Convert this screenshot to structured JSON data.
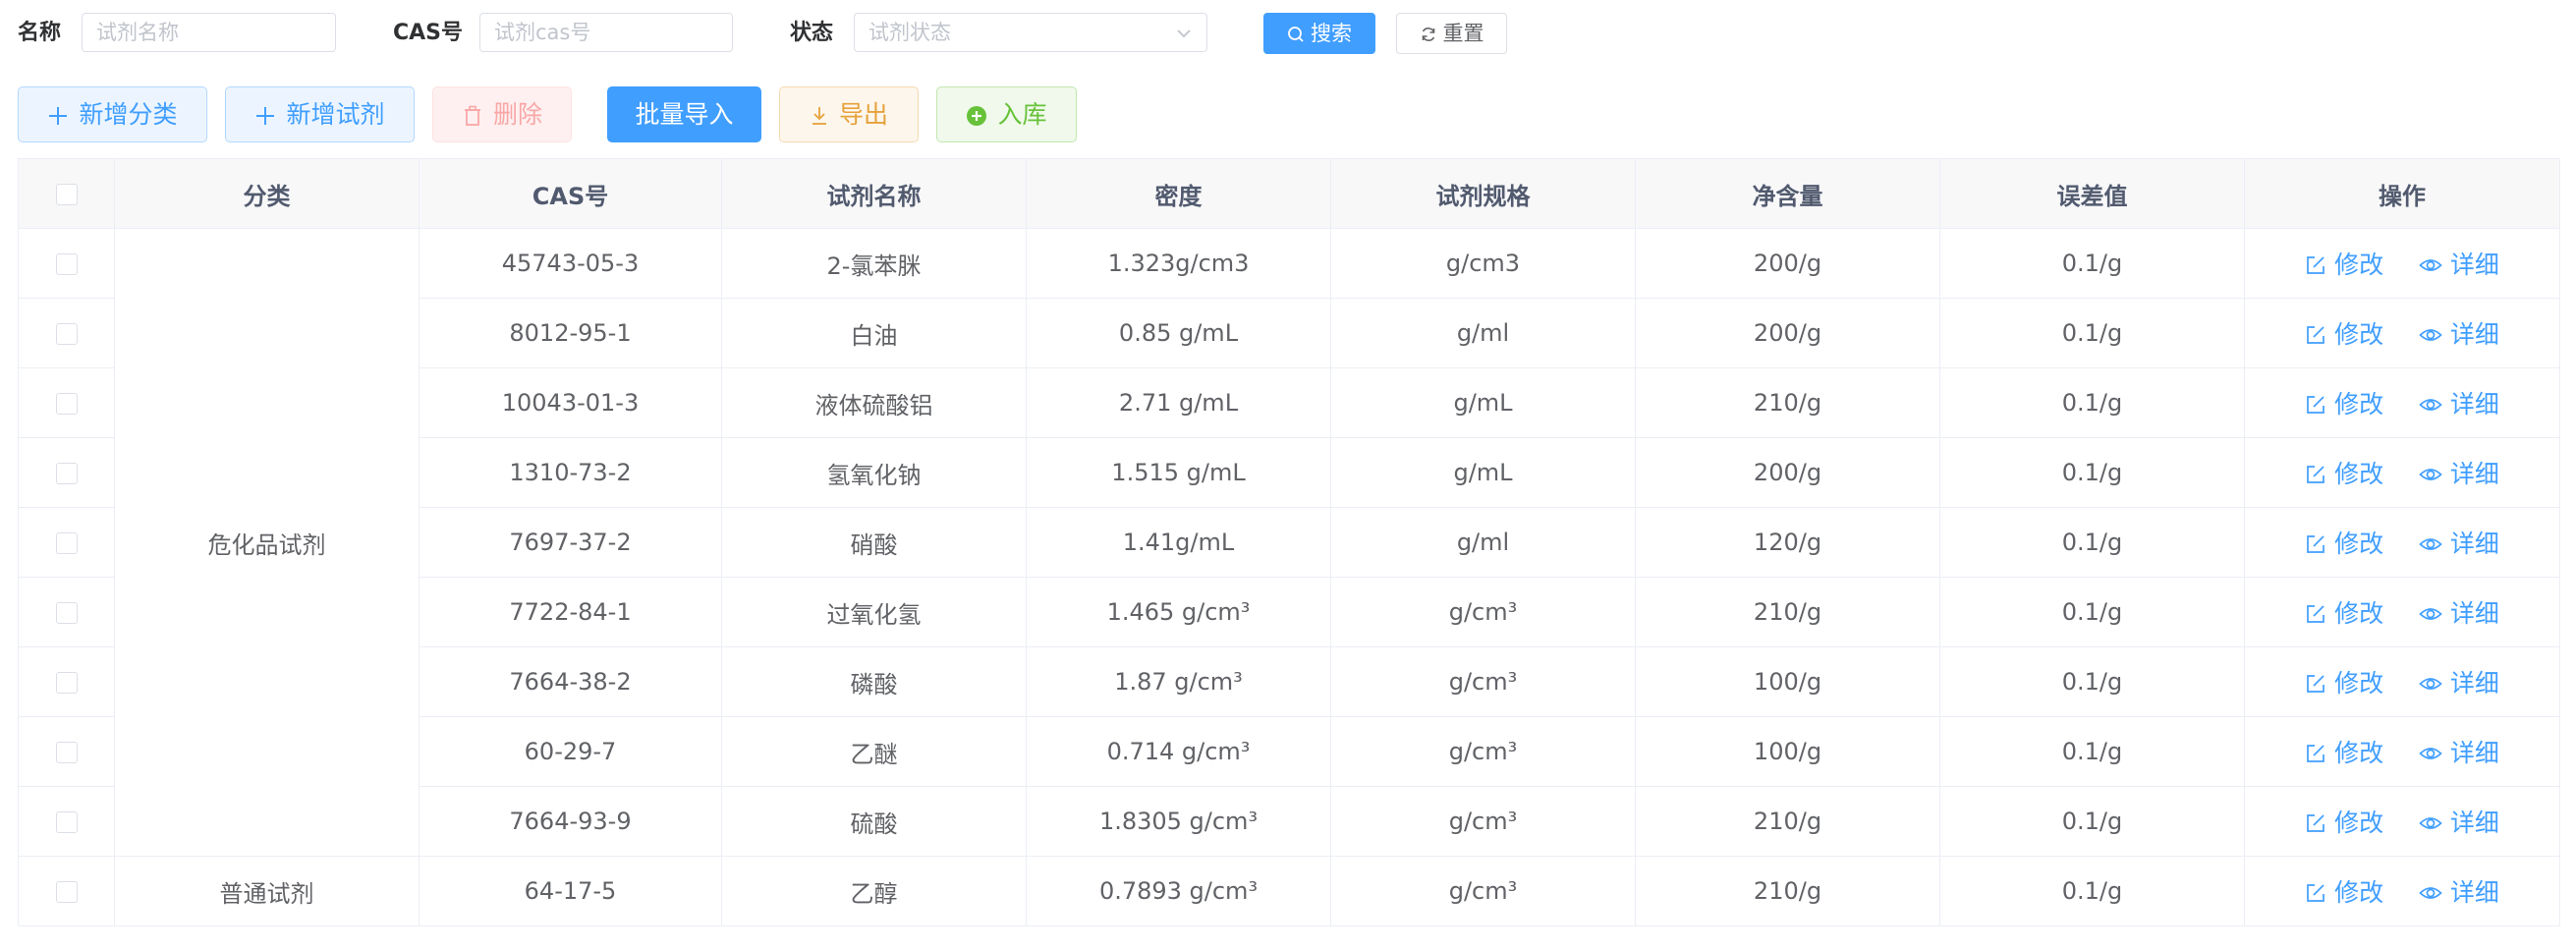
{
  "search": {
    "name_label": "名称",
    "name_placeholder": "试剂名称",
    "cas_label": "CAS号",
    "cas_placeholder": "试剂cas号",
    "status_label": "状态",
    "status_placeholder": "试剂状态",
    "search_button": "搜索",
    "reset_button": "重置"
  },
  "toolbar": {
    "add_category": "新增分类",
    "add_reagent": "新增试剂",
    "delete": "删除",
    "batch_import": "批量导入",
    "export": "导出",
    "stock_in": "入库"
  },
  "colors": {
    "primary": "#409eff",
    "warning": "#e6a23c",
    "success": "#67c23a",
    "danger": "#f56c6c"
  },
  "table": {
    "headers": [
      "分类",
      "CAS号",
      "试剂名称",
      "密度",
      "试剂规格",
      "净含量",
      "误差值",
      "操作"
    ],
    "action_edit": "修改",
    "action_detail": "详细",
    "groups": [
      {
        "category": "危化品试剂",
        "rows": [
          {
            "cas": "45743-05-3",
            "name": "2-氯苯脒",
            "density": "1.323g/cm3",
            "spec": "g/cm3",
            "net": "200/g",
            "error": "0.1/g"
          },
          {
            "cas": "8012-95-1",
            "name": "白油",
            "density": "0.85 g/mL",
            "spec": "g/ml",
            "net": "200/g",
            "error": "0.1/g"
          },
          {
            "cas": "10043-01-3",
            "name": "液体硫酸铝",
            "density": "2.71 g/mL",
            "spec": "g/mL",
            "net": "210/g",
            "error": "0.1/g"
          },
          {
            "cas": "1310-73-2",
            "name": "氢氧化钠",
            "density": "1.515 g/mL",
            "spec": "g/mL",
            "net": "200/g",
            "error": "0.1/g"
          },
          {
            "cas": "7697-37-2",
            "name": "硝酸",
            "density": "1.41g/mL",
            "spec": "g/ml",
            "net": "120/g",
            "error": "0.1/g"
          },
          {
            "cas": "7722-84-1",
            "name": "过氧化氢",
            "density": "1.465 g/cm³",
            "spec": "g/cm³",
            "net": "210/g",
            "error": "0.1/g"
          },
          {
            "cas": "7664-38-2",
            "name": "磷酸",
            "density": "1.87 g/cm³",
            "spec": "g/cm³",
            "net": "100/g",
            "error": "0.1/g"
          },
          {
            "cas": "60-29-7",
            "name": "乙醚",
            "density": "0.714 g/cm³",
            "spec": "g/cm³",
            "net": "100/g",
            "error": "0.1/g"
          },
          {
            "cas": "7664-93-9",
            "name": "硫酸",
            "density": "1.8305 g/cm³",
            "spec": "g/cm³",
            "net": "210/g",
            "error": "0.1/g"
          }
        ]
      },
      {
        "category": "普通试剂",
        "rows": [
          {
            "cas": "64-17-5",
            "name": "乙醇",
            "density": "0.7893 g/cm³",
            "spec": "g/cm³",
            "net": "210/g",
            "error": "0.1/g"
          }
        ]
      }
    ]
  }
}
